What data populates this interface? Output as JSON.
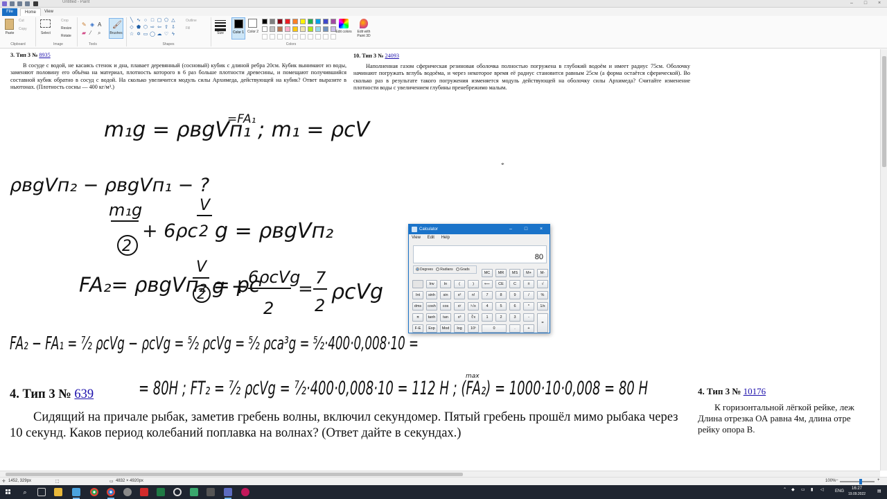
{
  "window": {
    "title": "Untitled - Paint",
    "controls": [
      "–",
      "□",
      "×"
    ]
  },
  "menu": {
    "file": "File",
    "tabs": [
      "Home",
      "View"
    ]
  },
  "ribbon": {
    "clipboard": {
      "paste": "Paste",
      "cut": "Cut",
      "copy": "Copy",
      "label": "Clipboard"
    },
    "image": {
      "select": "Select",
      "crop": "Crop",
      "resize": "Resize",
      "rotate": "Rotate",
      "label": "Image"
    },
    "tools": {
      "label": "Tools"
    },
    "brushes": "Brushes",
    "shapes": {
      "outline": "Outline",
      "fill": "Fill",
      "label": "Shapes"
    },
    "size": "Size",
    "color1": "Color 1",
    "color2": "Color 2",
    "colors_label": "Colors",
    "edit_colors": "Edit colors",
    "paint3d": "Edit with Paint 3D",
    "palette": [
      "#000000",
      "#7f7f7f",
      "#880015",
      "#ed1c24",
      "#ff7f27",
      "#fff200",
      "#22b14c",
      "#00a2e8",
      "#3f48cc",
      "#a349a4",
      "#ffffff",
      "#c3c3c3",
      "#b97a57",
      "#ffaec9",
      "#ffc90e",
      "#efe4b0",
      "#b5e61d",
      "#99d9ea",
      "#7092be",
      "#c8bfe7"
    ]
  },
  "tasks": {
    "t1": {
      "head": "3. Тип 3 № ",
      "link": "8935",
      "text": "В сосуде с водой, не касаясь стенок и дна, плавает деревянный (сосновый) кубик с длиной ребра 20см. Кубик вынимают из воды, заменяют половину его объёма на материал, плотность которого в 6 раз больше плотности древесины, и помещают получившийся составной кубик обратно в сосуд с водой. На сколько увеличится модуль силы Архимеда, действующей на кубик? Ответ выразите в ньютонах. (Плотность сосны — 400 кг/м³.)"
    },
    "t2": {
      "head": "10. Тип 3 № ",
      "link": "24093",
      "text": "Наполненная газом сферическая резиновая оболочка полностью погружена в глубокий водоём и имеет радиус 75см. Оболочку начинают погружать вглубь водоёма, и через некоторое время её радиус становится равным 25см (а форма остаётся сферической). Во сколько раз в результате такого погружения изменяется модуль действующей на оболочку силы Архимеда? Считайте изменение плотности воды с увеличением глубины пренебрежимо малым."
    },
    "t3": {
      "head": "4. Тип 3 № ",
      "link": "639",
      "text": "Сидящий на причале рыбак, заметив гребень волны, включил секундомер. Пятый гребень прошёл мимо рыбака через 10 секунд. Каков период колебаний поплавка на волнах? (Ответ дайте в секундах.)"
    },
    "t4": {
      "head": "4. Тип 3 № ",
      "link": "10176",
      "line1": "К горизонтальной лёгкой рейке, леж",
      "line2": "Длина отрезка ОА равна 4м, длина отре",
      "line3": "рейку опора В."
    }
  },
  "ink": {
    "l1": "m₁g = ρвgVп₁ ; m₁ = ρсV",
    "l1_label": "=FA₁",
    "l2": "ρвgVп₂ − ρвgVп₁ − ?",
    "l3a": "m₁g",
    "l3b": "2",
    "l3c": "+  6ρс",
    "l3d": "V",
    "l3e": "2",
    "l3f": "g = ρвgVп₂",
    "l4a": "FA₂= ρвgVп₂ =  ρс",
    "l4b": "V",
    "l4c": "2",
    "l4d": "g +",
    "l4e": "6ρсVg",
    "l4f": "2",
    "l4g": "=",
    "l4h": "7",
    "l4i": "2",
    "l4j": "ρсVg",
    "l5": "FA₂ − FA₁ = ⁷⁄₂ ρсVg − ρсVg = ⁵⁄₂ ρсVg = ⁵⁄₂ ρсa³g = ⁵⁄₂·400·0,008·10 =",
    "l6": "= 80Н ;   FT₂ = ⁷⁄₂ ρсVg = ⁷⁄₂·400·0,008·10 = 112 Н ; (FA₂) = 1000·10·0,008 = 80 Н",
    "l6_mark": "max"
  },
  "calculator": {
    "title": "Calculator",
    "menu": [
      "View",
      "Edit",
      "Help"
    ],
    "display": "80",
    "modes": [
      "Degrees",
      "Radians",
      "Grads"
    ],
    "rows": [
      [
        "",
        "",
        "",
        "",
        "",
        "MC",
        "MR",
        "MS",
        "M+",
        "M-"
      ],
      [
        "",
        "Inv",
        "ln",
        "(",
        ")",
        "⟵",
        "CE",
        "C",
        "±",
        "√"
      ],
      [
        "Int",
        "sinh",
        "sin",
        "x²",
        "n!",
        "7",
        "8",
        "9",
        "/",
        "%"
      ],
      [
        "dms",
        "cosh",
        "cos",
        "xʸ",
        "ʸ√x",
        "4",
        "5",
        "6",
        "*",
        "1/x"
      ],
      [
        "π",
        "tanh",
        "tan",
        "x³",
        "∛x",
        "1",
        "2",
        "3",
        "-",
        "="
      ],
      [
        "F-E",
        "Exp",
        "Mod",
        "log",
        "10ˣ",
        "0",
        "",
        ".",
        "+",
        ""
      ]
    ]
  },
  "status": {
    "pos": "1452, 329px",
    "size": "4832 × 4920px",
    "zoom": "100%"
  },
  "taskbar": {
    "lang": "ENG",
    "time": "16:27",
    "date": "19.09.2022"
  }
}
